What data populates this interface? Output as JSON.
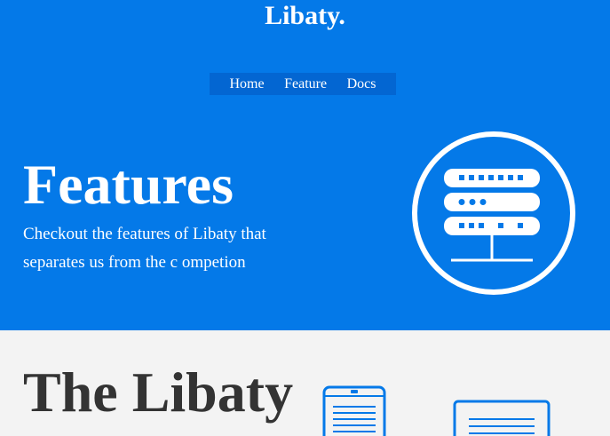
{
  "brand": {
    "name": "Libaty."
  },
  "nav": {
    "items": [
      {
        "label": "Home"
      },
      {
        "label": "Feature"
      },
      {
        "label": "Docs"
      }
    ]
  },
  "hero": {
    "title": "Features",
    "subtitle": "Checkout the features of Libaty that separates us from the c ompetion",
    "illustration": "server-rack-icon"
  },
  "section": {
    "title": "The Libaty",
    "icons": [
      "tablet-document-icon",
      "document-card-icon"
    ]
  },
  "colors": {
    "hero_bg": "#0479e8",
    "nav_bg": "#0366d2",
    "section_bg": "#f3f3f3",
    "text_dark": "#333333",
    "accent": "#0479e8"
  }
}
